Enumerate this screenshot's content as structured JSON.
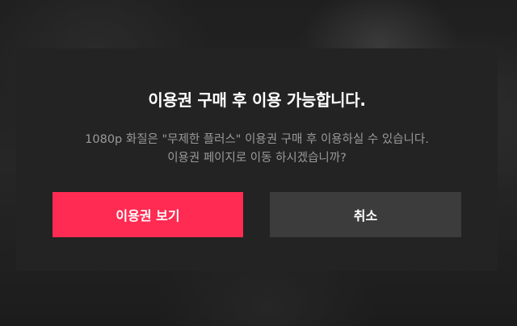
{
  "dialog": {
    "title": "이용권 구매 후 이용 가능합니다.",
    "message_line1": "1080p 화질은 \"무제한 플러스\" 이용권 구매 후 이용하실 수 있습니다.",
    "message_line2": "이용권 페이지로 이동 하시겠습니까?",
    "primary_button_label": "이용권 보기",
    "secondary_button_label": "취소"
  },
  "colors": {
    "primary_button": "#ff2b52",
    "secondary_button": "#3c3c3c",
    "dialog_background": "#232323"
  }
}
